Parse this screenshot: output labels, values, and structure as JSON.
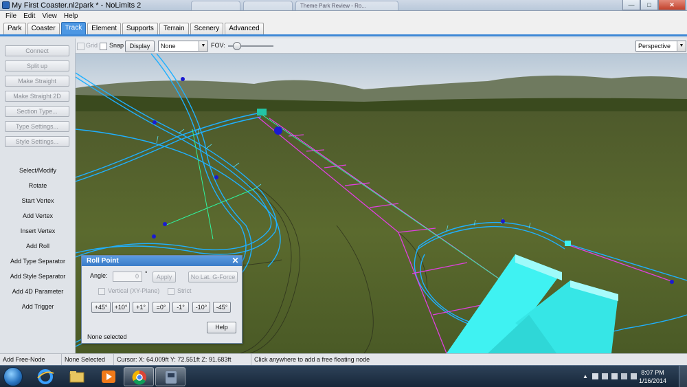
{
  "window": {
    "title": "My First Coaster.nl2park * - NoLimits 2",
    "background_tabs": [
      "",
      "",
      "Theme Park Review - Ro..."
    ]
  },
  "menu": [
    "File",
    "Edit",
    "View",
    "Help"
  ],
  "tabs": [
    {
      "label": "Park",
      "active": false
    },
    {
      "label": "Coaster",
      "active": false
    },
    {
      "label": "Track",
      "active": true
    },
    {
      "label": "Element",
      "active": false
    },
    {
      "label": "Supports",
      "active": false
    },
    {
      "label": "Terrain",
      "active": false
    },
    {
      "label": "Scenery",
      "active": false
    },
    {
      "label": "Advanced",
      "active": false
    }
  ],
  "left_panel": {
    "buttons": [
      "Connect",
      "Split up",
      "Make Straight",
      "Make Straight 2D",
      "Section Type...",
      "Type Settings...",
      "Style Settings..."
    ],
    "actions": [
      "Select/Modify",
      "Rotate",
      "Start Vertex",
      "Add Vertex",
      "Insert Vertex",
      "Add Roll",
      "Add Type Separator",
      "Add Style Separator",
      "Add 4D Parameter",
      "Add Trigger"
    ]
  },
  "toolbar": {
    "grid_label": "Grid",
    "snap_label": "Snap",
    "display_label": "Display",
    "display_select": "None",
    "fov_label": "FOV:",
    "view_select": "Perspective"
  },
  "dialog": {
    "title": "Roll Point",
    "angle_label": "Angle:",
    "angle_value": "0",
    "degree_symbol": "°",
    "apply_label": "Apply",
    "no_lat_label": "No Lat. G-Force",
    "vertical_label": "Vertical (XY-Plane)",
    "strict_label": "Strict",
    "step_buttons": [
      "+45°",
      "+10°",
      "+1°",
      "=0°",
      "-1°",
      "-10°",
      "-45°"
    ],
    "help_label": "Help",
    "selection_status": "None selected"
  },
  "status": {
    "mode": "Add Free-Node",
    "selection": "None Selected",
    "cursor": "Cursor: X: 64.009ft Y: 72.551ft Z: 91.683ft",
    "hint": "Click anywhere to add a free floating node"
  },
  "taskbar": {
    "time": "8:07 PM",
    "date": "1/16/2014"
  },
  "colors": {
    "track_blue": "#1fb0ff",
    "track_magenta": "#e040e0",
    "tab_active": "#4c97e3",
    "cyan_block": "#3ff2f2"
  }
}
